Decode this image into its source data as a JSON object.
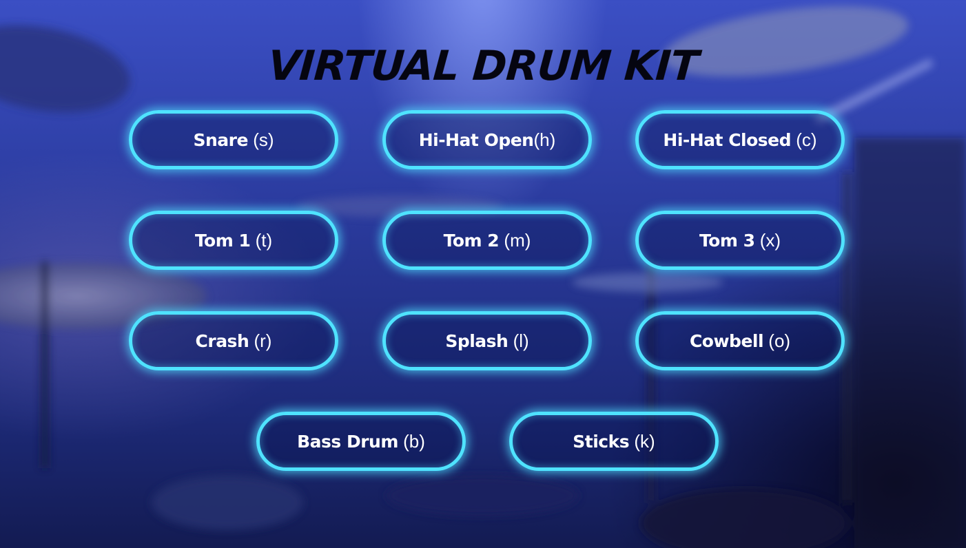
{
  "title": "VIRTUAL DRUM KIT",
  "pads": [
    {
      "name": "Snare",
      "sep": " ",
      "key": "(s)"
    },
    {
      "name": "Hi-Hat Open",
      "sep": "",
      "key": "(h)"
    },
    {
      "name": "Hi-Hat Closed",
      "sep": " ",
      "key": "(c)"
    },
    {
      "name": "Tom 1",
      "sep": " ",
      "key": "(t)"
    },
    {
      "name": "Tom 2",
      "sep": " ",
      "key": "(m)"
    },
    {
      "name": "Tom 3",
      "sep": " ",
      "key": "(x)"
    },
    {
      "name": "Crash",
      "sep": " ",
      "key": "(r)"
    },
    {
      "name": "Splash",
      "sep": " ",
      "key": "(l)"
    },
    {
      "name": "Cowbell",
      "sep": " ",
      "key": "(o)"
    },
    {
      "name": "Bass Drum",
      "sep": " ",
      "key": "(b)"
    },
    {
      "name": "Sticks",
      "sep": " ",
      "key": "(k)"
    }
  ],
  "colors": {
    "pad_border": "#4fe3ff",
    "pad_text": "#ffffff",
    "title": "#050510",
    "background": "#2a3a9c"
  }
}
